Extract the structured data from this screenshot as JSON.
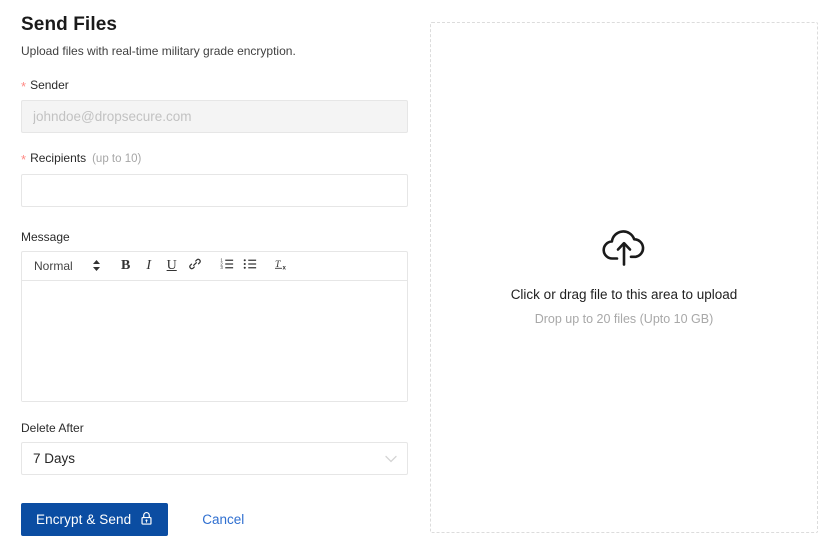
{
  "header": {
    "title": "Send Files",
    "subtitle": "Upload files with real-time military grade encryption."
  },
  "form": {
    "sender": {
      "label": "Sender",
      "required_marker": "*",
      "value": "",
      "placeholder": "johndoe@dropsecure.com",
      "disabled": true
    },
    "recipients": {
      "label": "Recipients",
      "required_marker": "*",
      "hint": "(up to 10)",
      "value": "",
      "placeholder": ""
    },
    "message": {
      "label": "Message",
      "value": "",
      "toolbar": {
        "format_select": "Normal",
        "buttons": [
          {
            "name": "bold-button",
            "glyph": "B"
          },
          {
            "name": "italic-button",
            "glyph": "I"
          },
          {
            "name": "underline-button",
            "glyph": "U"
          },
          {
            "name": "link-button",
            "glyph": "link-icon"
          },
          {
            "name": "ordered-list-button",
            "glyph": "ordered-list-icon"
          },
          {
            "name": "bullet-list-button",
            "glyph": "bullet-list-icon"
          },
          {
            "name": "clear-format-button",
            "glyph": "clear-format-icon"
          }
        ]
      }
    },
    "delete_after": {
      "label": "Delete After",
      "selected": "7 Days"
    }
  },
  "actions": {
    "submit_label": "Encrypt & Send",
    "submit_icon": "lock-icon",
    "cancel_label": "Cancel"
  },
  "dropzone": {
    "icon": "cloud-upload-icon",
    "title": "Click or drag file to this area to upload",
    "subtitle": "Drop up to 20 files (Upto 10 GB)"
  },
  "colors": {
    "primary": "#0b4da2",
    "link": "#2f6fd0",
    "required": "#ff8984",
    "border": "#e6e6e6",
    "dashed_border": "#dcdcdc",
    "disabled_bg": "#f4f4f4",
    "muted_text": "#a8a8a8"
  }
}
